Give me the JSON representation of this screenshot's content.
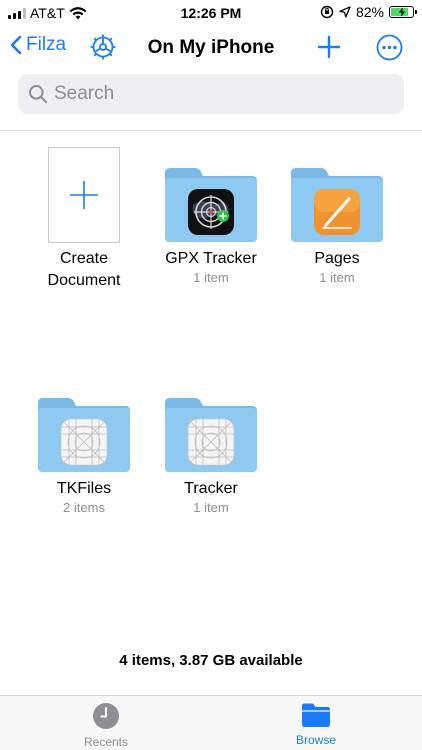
{
  "status_bar": {
    "carrier": "AT&T",
    "time": "12:26 PM",
    "battery_percent": "82%",
    "battery_level": 0.82
  },
  "nav": {
    "back_label": "Filza",
    "title": "On My iPhone"
  },
  "search": {
    "placeholder": "Search"
  },
  "create": {
    "label_line1": "Create",
    "label_line2": "Document"
  },
  "items": [
    {
      "name": "GPX Tracker",
      "meta": "1 item",
      "icon": "gpx-tracker-app-icon"
    },
    {
      "name": "Pages",
      "meta": "1 item",
      "icon": "pages-app-icon"
    },
    {
      "name": "TKFiles",
      "meta": "2 items",
      "icon": "generic-app-icon"
    },
    {
      "name": "Tracker",
      "meta": "1 item",
      "icon": "generic-app-icon"
    }
  ],
  "footer": {
    "summary": "4 items, 3.87 GB available"
  },
  "tabs": [
    {
      "label": "Recents",
      "icon": "clock-icon",
      "active": false
    },
    {
      "label": "Browse",
      "icon": "folder-icon",
      "active": true
    }
  ],
  "colors": {
    "accent": "#1a7cf5",
    "folder_front": "#8ec9f2",
    "folder_back": "#7ab9e8",
    "inactive_tab": "#8e8e93"
  }
}
